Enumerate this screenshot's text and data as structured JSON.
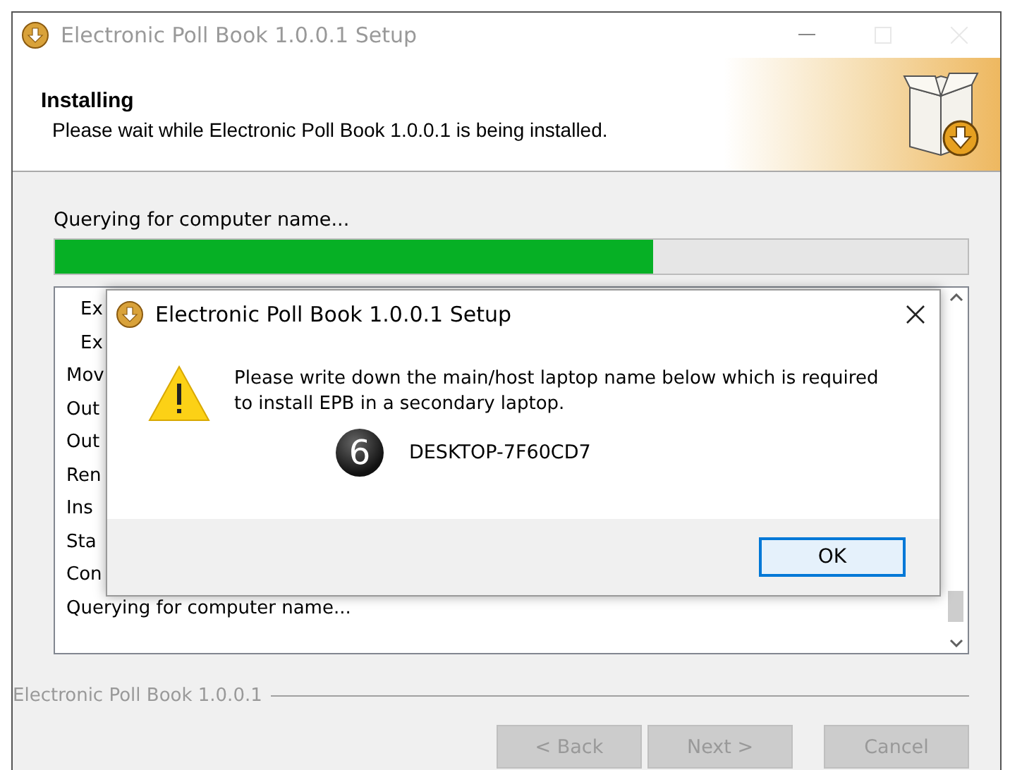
{
  "window": {
    "title": "Electronic Poll Book 1.0.0.1 Setup"
  },
  "header": {
    "title": "Installing",
    "subtitle": "Please wait while Electronic Poll Book 1.0.0.1 is being installed."
  },
  "status": "Querying for computer name...",
  "progress": {
    "level": 0.655
  },
  "log": [
    {
      "text": "Ex",
      "kind": "detail"
    },
    {
      "text": "Ex",
      "kind": "detail"
    },
    {
      "text": "Mov",
      "kind": "step"
    },
    {
      "text": "Out",
      "kind": "step"
    },
    {
      "text": "Out",
      "kind": "step"
    },
    {
      "text": "Ren",
      "kind": "step"
    },
    {
      "text": "Ins",
      "kind": "step"
    },
    {
      "text": "Sta",
      "kind": "step"
    },
    {
      "text": "Con",
      "kind": "step"
    },
    {
      "text": "Querying for computer name...",
      "kind": "step"
    }
  ],
  "dialog": {
    "title": "Electronic Poll Book 1.0.0.1 Setup",
    "message": "Please write down the main/host laptop name below which is required to install EPB in a secondary laptop.",
    "step_number": "6",
    "computer_name": "DESKTOP-7F60CD7",
    "button": {
      "label": "OK",
      "focused": true
    }
  },
  "footer": {
    "brand": "Electronic Poll Book 1.0.0.1"
  },
  "buttons": [
    {
      "label": "< Back",
      "disabled": true
    },
    {
      "label": "Next >",
      "disabled": true
    },
    {
      "label": "Cancel",
      "disabled": true
    }
  ]
}
